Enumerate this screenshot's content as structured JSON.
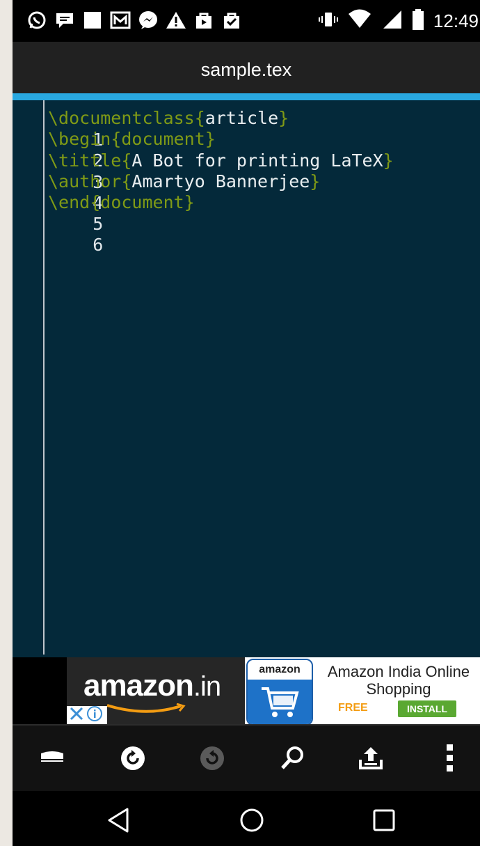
{
  "status_bar": {
    "time": "12:49",
    "left_icons": [
      "whatsapp-icon",
      "chat-bubble-icon",
      "square-icon",
      "gmail-icon",
      "messenger-icon",
      "warning-icon",
      "shopping-bag-icon",
      "shopping-check-icon"
    ],
    "right_icons": [
      "vibrate-icon",
      "wifi-icon",
      "signal-icon",
      "battery-icon"
    ]
  },
  "app_bar": {
    "title": "sample.tex"
  },
  "accent_color": "#29a8e0",
  "editor": {
    "background": "#04293a",
    "lines": [
      {
        "number": "1",
        "command": "\\documentclass",
        "open": "{",
        "argument": "article",
        "close": "}"
      },
      {
        "number": "2",
        "command": "\\begin",
        "open": "{",
        "argument": "document",
        "close": "}"
      },
      {
        "number": "3",
        "command": "\\tittle",
        "open": "{",
        "argument": "A Bot for printing LaTeX",
        "close": "}"
      },
      {
        "number": "4",
        "command": "\\author",
        "open": "{",
        "argument": "Amartyo Bannerjee",
        "close": "}"
      },
      {
        "number": "5",
        "command": "\\end",
        "open": "{",
        "argument": "document",
        "close": "}"
      },
      {
        "number": "6",
        "command": "",
        "open": "",
        "argument": "",
        "close": ""
      }
    ]
  },
  "ad": {
    "brand": "amazon",
    "brand_tld": ".in",
    "app_icon_label": "amazon",
    "app_name": "Amazon India Online Shopping",
    "price": "FREE",
    "install_label": "INSTALL"
  },
  "toolbar": {
    "items": [
      "keyboard-icon",
      "undo-icon",
      "redo-icon",
      "search-icon",
      "upload-icon",
      "more-vert-icon"
    ]
  },
  "nav_bar": {
    "items": [
      "back-icon",
      "home-icon",
      "recents-icon"
    ]
  }
}
